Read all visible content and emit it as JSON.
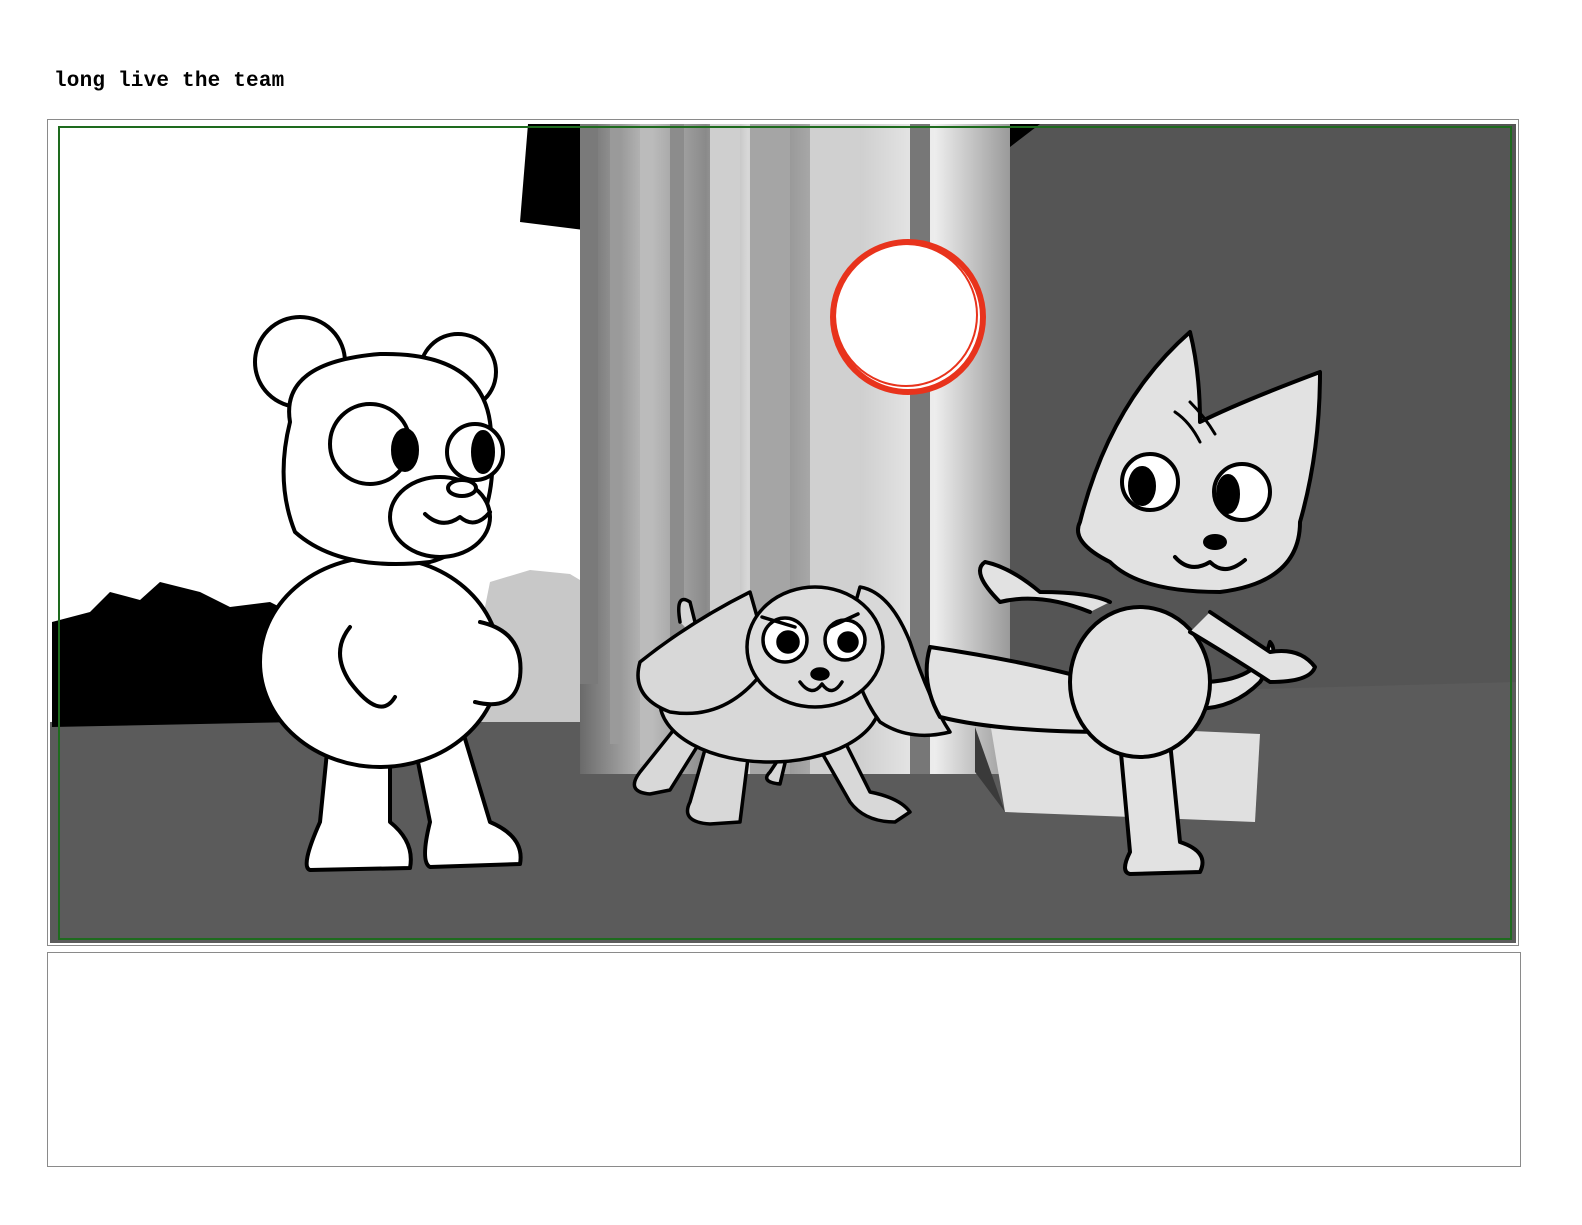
{
  "page": {
    "title": "long live the team"
  },
  "panel": {
    "safe_area_color": "#1e6b1e",
    "ball_color": "#e8331c",
    "characters": [
      "bear",
      "puppy",
      "cat"
    ]
  },
  "caption": {
    "text": ""
  }
}
